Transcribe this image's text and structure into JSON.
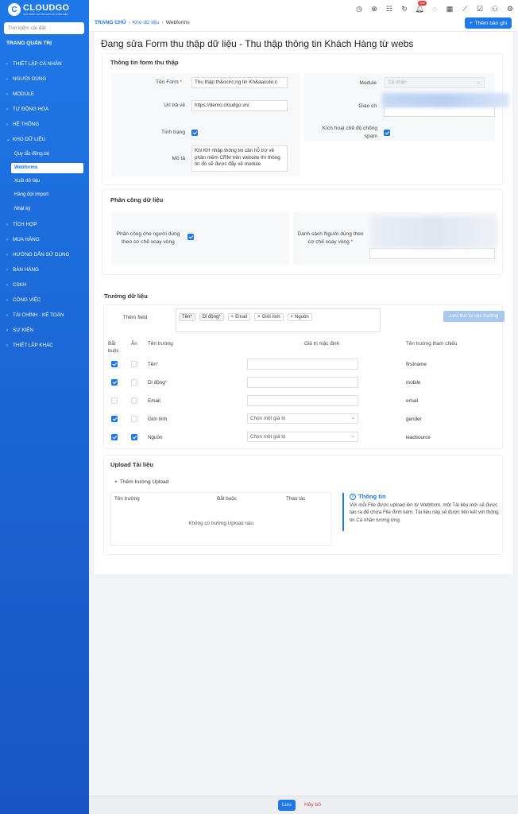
{
  "brand": {
    "name": "CLOUDGO",
    "tagline": "GIẢI PHÁP CHUYỂN ĐỔI SỐ TOÀN DIỆN",
    "accent": "#1f78e8"
  },
  "sidebar": {
    "search_placeholder": "Tìm kiếm cài đặt",
    "home": "TRANG QUẢN TRỊ",
    "items": [
      "THIẾT LẬP CÁ NHÂN",
      "NGƯỜI DÙNG",
      "MODULE",
      "TỰ ĐỘNG HÓA",
      "HỆ THỐNG",
      "KHO DỮ LIỆU",
      "TÍCH HỢP",
      "MUA HÀNG",
      "HƯỚNG DẪN SỬ DỤNG",
      "BÁN HÀNG",
      "CSKH",
      "CÔNG VIỆC",
      "TÀI CHÍNH - KẾ TOÁN",
      "SỰ KIỆN",
      "THIẾT LẬP KHÁC"
    ],
    "subitems": [
      "Quy tắc đồng bộ",
      "Webforms",
      "Xuất dữ liệu",
      "Hàng đợi import",
      "Nhật ký"
    ]
  },
  "topbar": {
    "badge": "106",
    "breadcrumb": {
      "home": "TRANG CHỦ",
      "parent": "Kho dữ liệu",
      "current": "Webforms"
    },
    "add_button": "Thêm bản ghi"
  },
  "page": {
    "title": "Đang sửa Form thu thập dữ liệu - Thu thập thông tin Khách Hàng từ webs"
  },
  "form_info": {
    "title": "Thông tin form thu thập",
    "name_label": "Tên Form",
    "name_value": "Thu thập th&ocirc;ng tin Kh&aacute;c",
    "return_url_label": "Url trả về",
    "return_url_value": "https://demo.cloudgo.vn/",
    "status_label": "Tình trạng",
    "desc_label": "Mô tả",
    "desc_value": "Khi KH nhập thông tin cần hỗ trợ về phần mềm CRM trên website thì thông tin đó sẽ được đẩy về module",
    "module_label": "Module",
    "module_value": "Cá nhân",
    "assign_label": "Giao ch",
    "spam_label": "Kích hoạt chế độ chống spam"
  },
  "assign": {
    "title": "Phân công dữ liệu",
    "round_robin_label": "Phân công cho người dùng theo cơ chế xoay vòng",
    "users_label": "Danh sách Người dùng theo cơ chế xoay vòng"
  },
  "fields": {
    "title": "Trường dữ liệu",
    "add_field_label": "Thêm field",
    "chips": [
      "Tên*",
      "Di động*",
      "Email",
      "Giới tính",
      "Nguồn"
    ],
    "save_order_button": "Lưu thứ tự các trường",
    "headers": {
      "required": "Bắt buộc",
      "hidden": "Ẩn",
      "name": "Tên trường",
      "default": "Giá trị mặc định",
      "ref": "Tên trường tham chiếu"
    },
    "rows": [
      {
        "name": "Tên",
        "req_mark": "*",
        "ref": "firstname",
        "default": "",
        "type": "input",
        "required": true,
        "hidden": false
      },
      {
        "name": "Di động",
        "req_mark": "*",
        "ref": "mobile",
        "default": "",
        "type": "input",
        "required": true,
        "hidden": false
      },
      {
        "name": "Email",
        "req_mark": "",
        "ref": "email",
        "default": "",
        "type": "input",
        "required": false,
        "hidden": false
      },
      {
        "name": "Giới tính",
        "req_mark": "",
        "ref": "gender",
        "default": "Chọn một giá trị",
        "type": "select",
        "required": true,
        "hidden": false
      },
      {
        "name": "Nguồn",
        "req_mark": "",
        "ref": "leadsource",
        "default": "Chọn một giá trị",
        "type": "select",
        "required": true,
        "hidden": true
      }
    ]
  },
  "upload": {
    "title": "Upload Tài liệu",
    "add_button": "Thêm trường Upload",
    "headers": {
      "name": "Tên trường",
      "required": "Bắt buộc",
      "action": "Thao tác"
    },
    "empty": "Không có trường Upload nào.",
    "info_title": "Thông tin",
    "info_body": "Với mỗi File được upload lên từ Webform, một Tài liệu mới sẽ được tạo ra để chứa File đính kèm. Tài liệu này sẽ được liên kết với thông tin Cá nhân tương ứng."
  },
  "footer": {
    "save": "Lưu",
    "cancel": "Hủy bỏ"
  }
}
